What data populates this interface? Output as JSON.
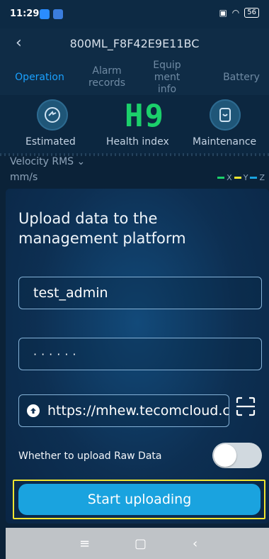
{
  "status_bar": {
    "time": "11:29",
    "battery": "56"
  },
  "app_bar": {
    "title": "800ML_F8F42E9E11BC"
  },
  "tabs": [
    {
      "label": "Operation"
    },
    {
      "label": "Alarm records"
    },
    {
      "label": "Equip ment info"
    },
    {
      "label": "Battery"
    }
  ],
  "status_row": {
    "estimated_label": "Estimated",
    "health_value": "H9",
    "health_label": "Health index",
    "maintenance_label": "Maintenance"
  },
  "chart_header": {
    "metric": "Velocity RMS",
    "unit": "mm/s",
    "legend": [
      "X",
      "Y",
      "Z"
    ]
  },
  "modal": {
    "title": "Upload data to the management platform",
    "username_value": "test_admin",
    "password_value": "······",
    "url_value": "https://mhew.tecomcloud.com",
    "raw_data_label": "Whether to upload Raw Data",
    "raw_data_enabled": false,
    "upload_button": "Start uploading"
  },
  "colors": {
    "accent": "#1aa3df",
    "health_green": "#1bd06b",
    "highlight": "#f0e530"
  }
}
